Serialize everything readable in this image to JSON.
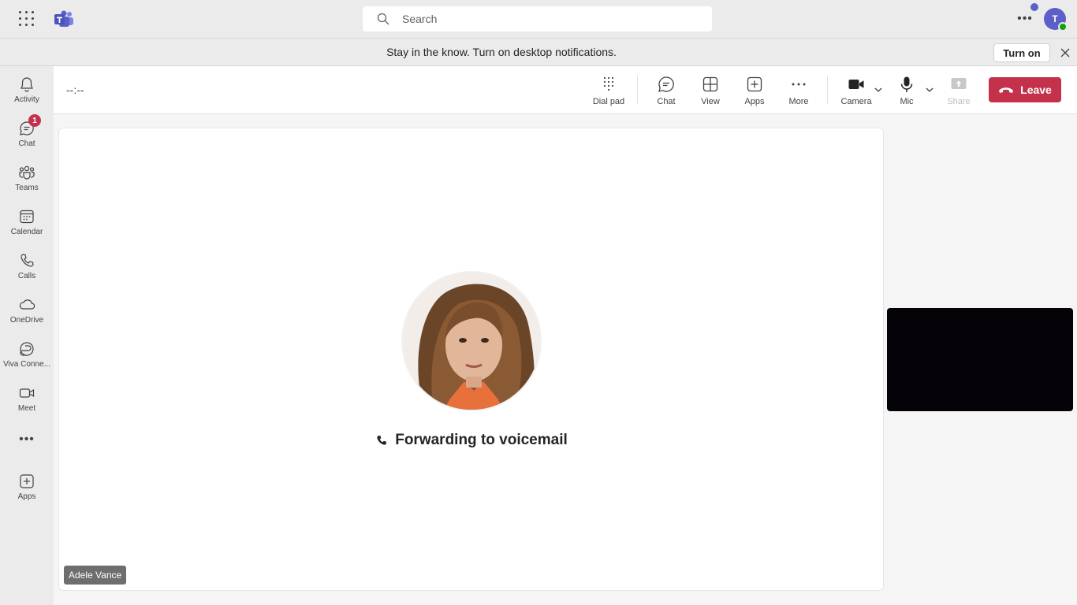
{
  "topbar": {
    "search_placeholder": "Search",
    "avatar_initial": "T"
  },
  "banner": {
    "text": "Stay in the know. Turn on desktop notifications.",
    "button_label": "Turn on"
  },
  "rail": {
    "items": [
      {
        "label": "Activity",
        "icon": "bell-icon"
      },
      {
        "label": "Chat",
        "icon": "chat-icon",
        "badge": "1"
      },
      {
        "label": "Teams",
        "icon": "teams-icon"
      },
      {
        "label": "Calendar",
        "icon": "calendar-icon"
      },
      {
        "label": "Calls",
        "icon": "phone-icon"
      },
      {
        "label": "OneDrive",
        "icon": "cloud-icon"
      },
      {
        "label": "Viva Conne...",
        "icon": "viva-connections-icon"
      },
      {
        "label": "Meet",
        "icon": "video-icon"
      },
      {
        "label": "Apps",
        "icon": "add-apps-icon"
      }
    ]
  },
  "call": {
    "timer": "--:--",
    "tools": {
      "dialpad": "Dial pad",
      "chat": "Chat",
      "view": "View",
      "apps": "Apps",
      "more": "More",
      "camera": "Camera",
      "mic": "Mic",
      "share": "Share"
    },
    "leave_label": "Leave",
    "status": "Forwarding to voicemail",
    "participant_name": "Adele Vance"
  },
  "colors": {
    "accent": "#5b5fc7",
    "leave": "#c4314b",
    "badge": "#c4314b",
    "presence": "#13a10e"
  }
}
